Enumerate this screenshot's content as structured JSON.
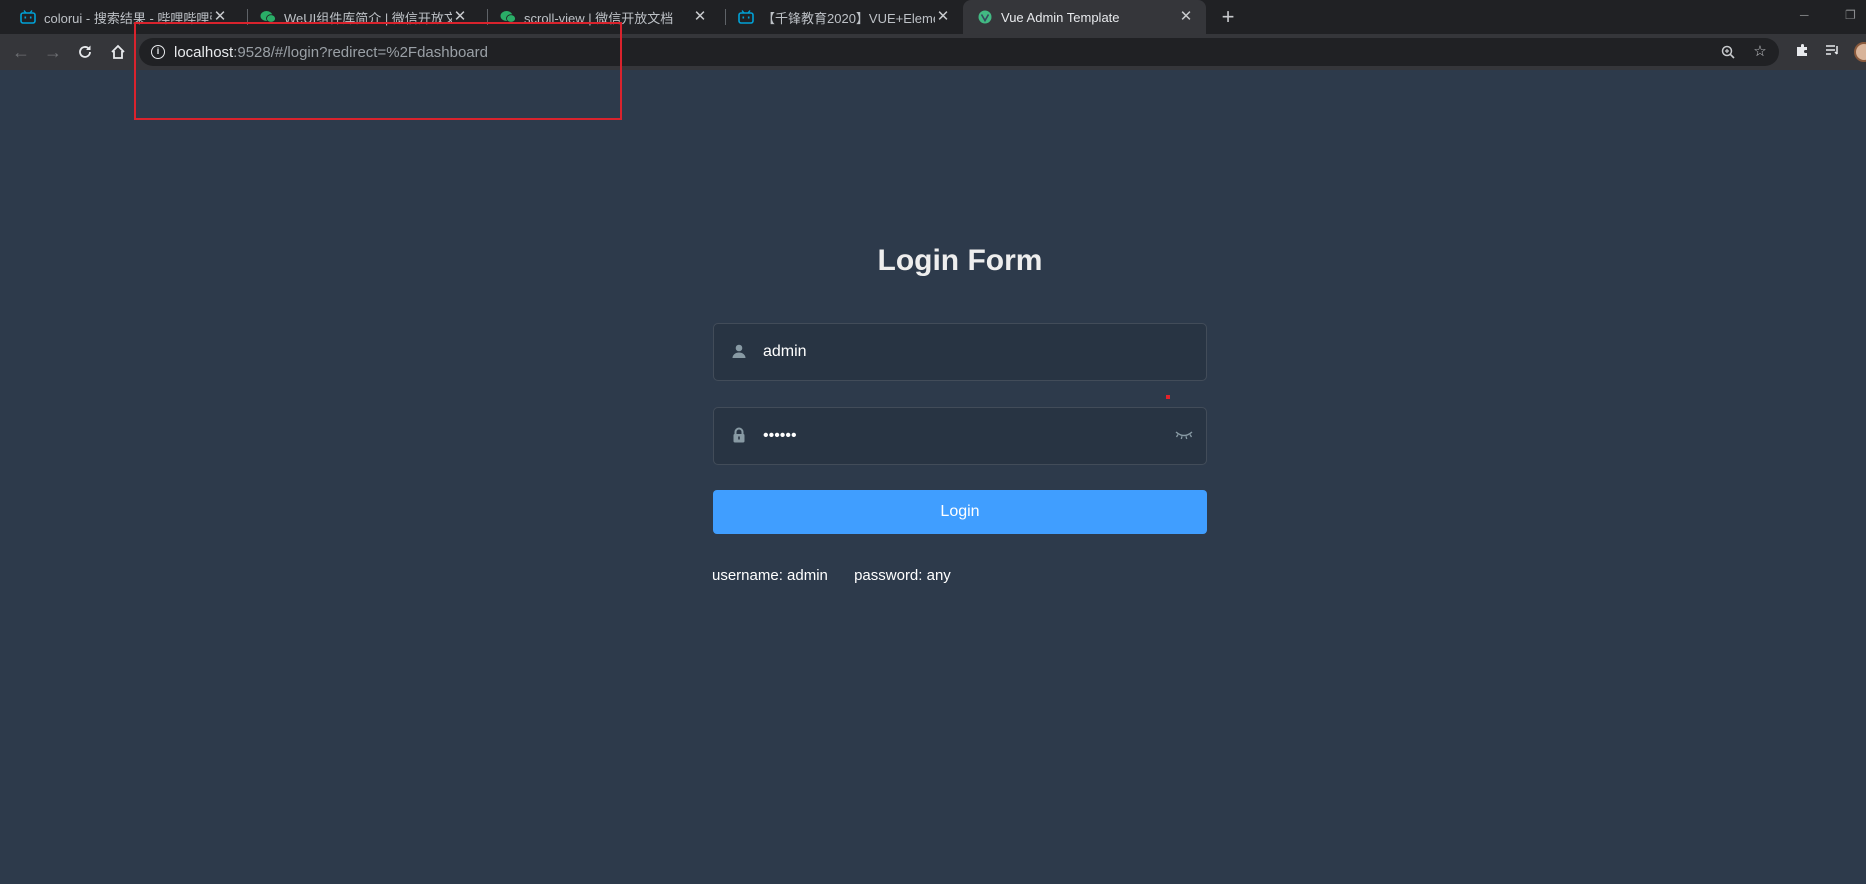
{
  "browser": {
    "tabs": [
      {
        "title": "colorui - 搜索结果 - 哔哩哔哩弹",
        "favicon": "bilibili-icon",
        "active": false
      },
      {
        "title": "WeUI组件库简介 | 微信开放文档",
        "favicon": "wechat-icon",
        "active": false
      },
      {
        "title": "scroll-view | 微信开放文档",
        "favicon": "wechat-icon",
        "active": false
      },
      {
        "title": "【千锋教育2020】VUE+Elemen",
        "favicon": "bilibili-icon",
        "active": false
      },
      {
        "title": "Vue Admin Template",
        "favicon": "vue-icon",
        "active": true
      }
    ],
    "close_glyph": "✕",
    "new_tab_glyph": "+",
    "url_host": "localhost",
    "url_rest": ":9528/#/login?redirect=%2Fdashboard"
  },
  "login": {
    "title": "Login Form",
    "username_value": "admin",
    "password_value": "••••••",
    "button_label": "Login",
    "tip_username": "username: admin",
    "tip_password": "password: any"
  },
  "colors": {
    "page_bg": "#2d3a4b",
    "input_bg": "#283443",
    "button": "#409eff",
    "annotation": "#d9232d"
  }
}
